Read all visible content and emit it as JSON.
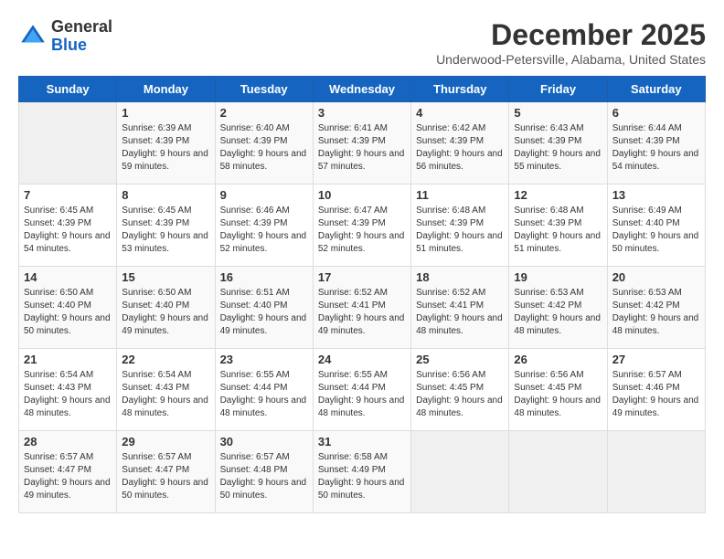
{
  "header": {
    "logo_general": "General",
    "logo_blue": "Blue",
    "title": "December 2025",
    "subtitle": "Underwood-Petersville, Alabama, United States"
  },
  "weekdays": [
    "Sunday",
    "Monday",
    "Tuesday",
    "Wednesday",
    "Thursday",
    "Friday",
    "Saturday"
  ],
  "weeks": [
    [
      {
        "day": "",
        "empty": true
      },
      {
        "day": "1",
        "sunrise": "6:39 AM",
        "sunset": "4:39 PM",
        "daylight": "9 hours and 59 minutes."
      },
      {
        "day": "2",
        "sunrise": "6:40 AM",
        "sunset": "4:39 PM",
        "daylight": "9 hours and 58 minutes."
      },
      {
        "day": "3",
        "sunrise": "6:41 AM",
        "sunset": "4:39 PM",
        "daylight": "9 hours and 57 minutes."
      },
      {
        "day": "4",
        "sunrise": "6:42 AM",
        "sunset": "4:39 PM",
        "daylight": "9 hours and 56 minutes."
      },
      {
        "day": "5",
        "sunrise": "6:43 AM",
        "sunset": "4:39 PM",
        "daylight": "9 hours and 55 minutes."
      },
      {
        "day": "6",
        "sunrise": "6:44 AM",
        "sunset": "4:39 PM",
        "daylight": "9 hours and 54 minutes."
      }
    ],
    [
      {
        "day": "7",
        "sunrise": "6:45 AM",
        "sunset": "4:39 PM",
        "daylight": "9 hours and 54 minutes."
      },
      {
        "day": "8",
        "sunrise": "6:45 AM",
        "sunset": "4:39 PM",
        "daylight": "9 hours and 53 minutes."
      },
      {
        "day": "9",
        "sunrise": "6:46 AM",
        "sunset": "4:39 PM",
        "daylight": "9 hours and 52 minutes."
      },
      {
        "day": "10",
        "sunrise": "6:47 AM",
        "sunset": "4:39 PM",
        "daylight": "9 hours and 52 minutes."
      },
      {
        "day": "11",
        "sunrise": "6:48 AM",
        "sunset": "4:39 PM",
        "daylight": "9 hours and 51 minutes."
      },
      {
        "day": "12",
        "sunrise": "6:48 AM",
        "sunset": "4:39 PM",
        "daylight": "9 hours and 51 minutes."
      },
      {
        "day": "13",
        "sunrise": "6:49 AM",
        "sunset": "4:40 PM",
        "daylight": "9 hours and 50 minutes."
      }
    ],
    [
      {
        "day": "14",
        "sunrise": "6:50 AM",
        "sunset": "4:40 PM",
        "daylight": "9 hours and 50 minutes."
      },
      {
        "day": "15",
        "sunrise": "6:50 AM",
        "sunset": "4:40 PM",
        "daylight": "9 hours and 49 minutes."
      },
      {
        "day": "16",
        "sunrise": "6:51 AM",
        "sunset": "4:40 PM",
        "daylight": "9 hours and 49 minutes."
      },
      {
        "day": "17",
        "sunrise": "6:52 AM",
        "sunset": "4:41 PM",
        "daylight": "9 hours and 49 minutes."
      },
      {
        "day": "18",
        "sunrise": "6:52 AM",
        "sunset": "4:41 PM",
        "daylight": "9 hours and 48 minutes."
      },
      {
        "day": "19",
        "sunrise": "6:53 AM",
        "sunset": "4:42 PM",
        "daylight": "9 hours and 48 minutes."
      },
      {
        "day": "20",
        "sunrise": "6:53 AM",
        "sunset": "4:42 PM",
        "daylight": "9 hours and 48 minutes."
      }
    ],
    [
      {
        "day": "21",
        "sunrise": "6:54 AM",
        "sunset": "4:43 PM",
        "daylight": "9 hours and 48 minutes."
      },
      {
        "day": "22",
        "sunrise": "6:54 AM",
        "sunset": "4:43 PM",
        "daylight": "9 hours and 48 minutes."
      },
      {
        "day": "23",
        "sunrise": "6:55 AM",
        "sunset": "4:44 PM",
        "daylight": "9 hours and 48 minutes."
      },
      {
        "day": "24",
        "sunrise": "6:55 AM",
        "sunset": "4:44 PM",
        "daylight": "9 hours and 48 minutes."
      },
      {
        "day": "25",
        "sunrise": "6:56 AM",
        "sunset": "4:45 PM",
        "daylight": "9 hours and 48 minutes."
      },
      {
        "day": "26",
        "sunrise": "6:56 AM",
        "sunset": "4:45 PM",
        "daylight": "9 hours and 48 minutes."
      },
      {
        "day": "27",
        "sunrise": "6:57 AM",
        "sunset": "4:46 PM",
        "daylight": "9 hours and 49 minutes."
      }
    ],
    [
      {
        "day": "28",
        "sunrise": "6:57 AM",
        "sunset": "4:47 PM",
        "daylight": "9 hours and 49 minutes."
      },
      {
        "day": "29",
        "sunrise": "6:57 AM",
        "sunset": "4:47 PM",
        "daylight": "9 hours and 50 minutes."
      },
      {
        "day": "30",
        "sunrise": "6:57 AM",
        "sunset": "4:48 PM",
        "daylight": "9 hours and 50 minutes."
      },
      {
        "day": "31",
        "sunrise": "6:58 AM",
        "sunset": "4:49 PM",
        "daylight": "9 hours and 50 minutes."
      },
      {
        "day": "",
        "empty": true
      },
      {
        "day": "",
        "empty": true
      },
      {
        "day": "",
        "empty": true
      }
    ]
  ]
}
